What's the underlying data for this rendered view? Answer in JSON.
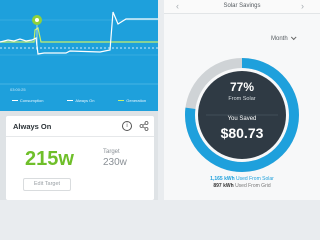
{
  "chart": {
    "time_label": "03:00:25",
    "legend": {
      "consumption": "Consumption",
      "always_on": "Always On",
      "generation": "Generation"
    },
    "marker_icon": "gear-icon",
    "colors": {
      "background": "#1ea0dc",
      "generation": "#c6f06b",
      "line": "#ffffff"
    }
  },
  "always_on_card": {
    "title": "Always On",
    "value": "215w",
    "target_label": "Target",
    "target_value": "230w",
    "edit_button": "Edit Target",
    "value_color": "#6fbf2a"
  },
  "solar_savings": {
    "title": "Solar Savings",
    "period": "Month",
    "percent": "77%",
    "percent_value": 77,
    "from_solar_label": "From Solar",
    "you_saved_label": "You Saved",
    "saved_amount": "$80.73",
    "solar_kwh": "1,165 kWh",
    "solar_used_label": "Used From Solar",
    "grid_kwh": "897 kWh",
    "grid_used_label": "Used From Grid",
    "colors": {
      "ring": "#1ea0dc",
      "ring_track": "#cfd3d6",
      "inner": "#2f3a44"
    }
  }
}
